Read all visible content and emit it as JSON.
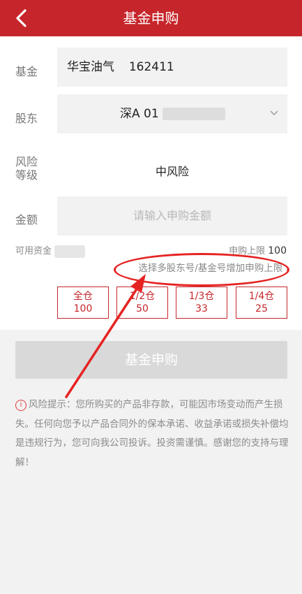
{
  "header": {
    "title": "基金申购",
    "back_icon": "chevron-left-icon"
  },
  "form": {
    "fund": {
      "label": "基金",
      "name": "华宝油气",
      "code": "162411"
    },
    "holder": {
      "label": "股东",
      "value": "深A 01",
      "dropdown_icon": "chevron-down-icon"
    },
    "risk": {
      "label_line1": "风险",
      "label_line2": "等级",
      "value": "中风险"
    },
    "amount": {
      "label": "金额",
      "placeholder": "请输入申购金额"
    },
    "available_label": "可用资金",
    "limit_label": "申购上限",
    "limit_value": "100",
    "link_text": "选择多股东号/基金号增加申购上限",
    "link_arrow": "›"
  },
  "quick_buttons": [
    {
      "label": "全仓",
      "value": "100"
    },
    {
      "label": "1/2仓",
      "value": "50"
    },
    {
      "label": "1/3仓",
      "value": "33"
    },
    {
      "label": "1/4仓",
      "value": "25"
    }
  ],
  "submit_label": "基金申购",
  "notice": {
    "icon": "info-icon",
    "text": "风险提示：您所购买的产品非存款，可能因市场变动而产生损失。任何向您予以产品合同外的保本承诺、收益承诺或损失补偿均是违规行为，您可向我公司投诉。投资需谨慎。感谢您的支持与理解！"
  },
  "colors": {
    "brand_red": "#c6262b",
    "annotation_red": "#e62323"
  }
}
